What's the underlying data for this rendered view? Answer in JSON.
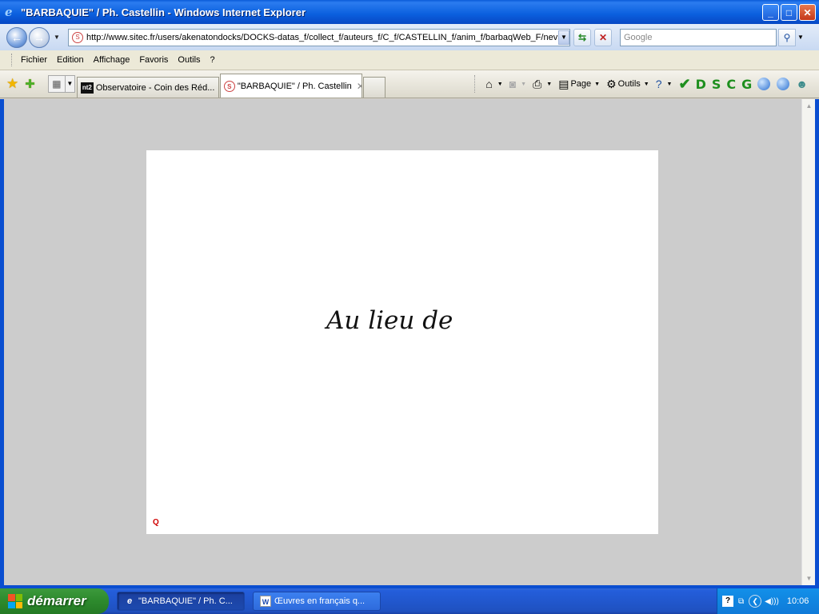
{
  "window": {
    "title": "\"BARBAQUIE\" / Ph. Castellin - Windows Internet Explorer"
  },
  "address": {
    "url": "http://www.sitec.fr/users/akenatondocks/DOCKS-datas_f/collect_f/auteurs_f/C_f/CASTELLIN_f/anim_f/barbaqWeb_F/nev",
    "search_placeholder": "Google"
  },
  "menu": {
    "items": [
      "Fichier",
      "Edition",
      "Affichage",
      "Favoris",
      "Outils",
      "?"
    ]
  },
  "tabs": [
    {
      "label": "Observatoire - Coin des Réd...",
      "icon": "nt2"
    },
    {
      "label": "\"BARBAQUIE\" / Ph. Castellin",
      "icon": "S"
    }
  ],
  "commands": {
    "page_label": "Page",
    "tools_label": "Outils",
    "letters": [
      "D",
      "S",
      "C",
      "G"
    ]
  },
  "slide": {
    "text": "Au lieu de",
    "corner_mark": "Q"
  },
  "taskbar": {
    "start_label": "démarrer",
    "tasks": [
      {
        "label": "\"BARBAQUIE\" / Ph. C..."
      },
      {
        "label": "Œuvres en français q..."
      }
    ],
    "clock": "10:06"
  }
}
